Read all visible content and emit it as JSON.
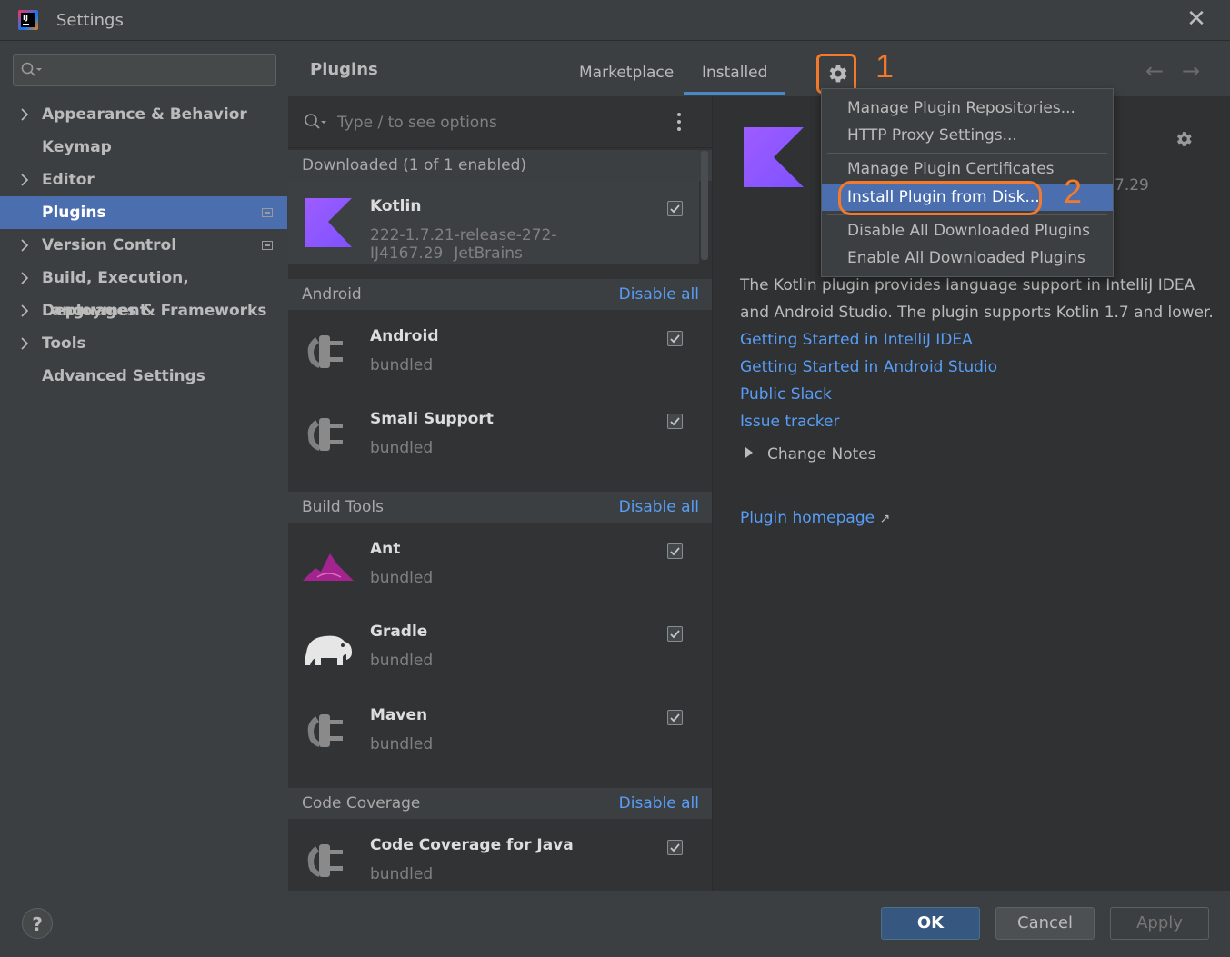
{
  "window": {
    "title": "Settings"
  },
  "sidebar": {
    "search_placeholder": "",
    "items": [
      {
        "label": "Appearance & Behavior",
        "chevron": true
      },
      {
        "label": "Keymap",
        "chevron": false
      },
      {
        "label": "Editor",
        "chevron": true
      },
      {
        "label": "Plugins",
        "chevron": false,
        "selected": true
      },
      {
        "label": "Version Control",
        "chevron": true
      },
      {
        "label": "Build, Execution, Deployment",
        "chevron": true
      },
      {
        "label": "Languages & Frameworks",
        "chevron": true
      },
      {
        "label": "Tools",
        "chevron": true
      },
      {
        "label": "Advanced Settings",
        "chevron": false
      }
    ]
  },
  "header": {
    "title": "Plugins",
    "tabs": [
      "Marketplace",
      "Installed"
    ],
    "active_tab": "Installed"
  },
  "annotations": {
    "callout_1": "1",
    "callout_2": "2",
    "color": "#f27a2a"
  },
  "list": {
    "search_placeholder": "Type / to see options",
    "downloaded_header": "Downloaded (1 of 1 enabled)",
    "groups": {
      "android": {
        "title": "Android",
        "action": "Disable all"
      },
      "build_tools": {
        "title": "Build Tools",
        "action": "Disable all"
      },
      "code_coverage": {
        "title": "Code Coverage",
        "action": "Disable all"
      }
    },
    "plugins": {
      "kotlin": {
        "name": "Kotlin",
        "version": "222-1.7.21-release-272-IJ4167.29",
        "vendor": "JetBrains",
        "enabled": true
      },
      "android": {
        "name": "Android",
        "sub": "bundled",
        "enabled": true
      },
      "smali": {
        "name": "Smali Support",
        "sub": "bundled",
        "enabled": true
      },
      "ant": {
        "name": "Ant",
        "sub": "bundled",
        "enabled": true
      },
      "gradle": {
        "name": "Gradle",
        "sub": "bundled",
        "enabled": true
      },
      "maven": {
        "name": "Maven",
        "sub": "bundled",
        "enabled": true
      },
      "coverage_java": {
        "name": "Code Coverage for Java",
        "sub": "bundled",
        "enabled": true
      }
    }
  },
  "dropdown": {
    "items": [
      "Manage Plugin Repositories...",
      "HTTP Proxy Settings...",
      "Manage Plugin Certificates",
      "Install Plugin from Disk...",
      "Disable All Downloaded Plugins",
      "Enable All Downloaded Plugins"
    ],
    "selected": "Install Plugin from Disk..."
  },
  "details": {
    "version_fragment": "7.29",
    "description_line1": "The Kotlin plugin provides language support in IntelliJ IDEA",
    "description_line2": "and Android Studio. The plugin supports Kotlin 1.7 and lower.",
    "links": [
      "Getting Started in IntelliJ IDEA",
      "Getting Started in Android Studio",
      "Public Slack",
      "Issue tracker"
    ],
    "change_notes": "Change Notes",
    "homepage": "Plugin homepage",
    "homepage_arrow": "↗"
  },
  "footer": {
    "help": "?",
    "ok": "OK",
    "cancel": "Cancel",
    "apply": "Apply"
  },
  "colors": {
    "accent": "#4b6eaf",
    "link": "#589df6",
    "kotlin": "#7f52ff"
  }
}
